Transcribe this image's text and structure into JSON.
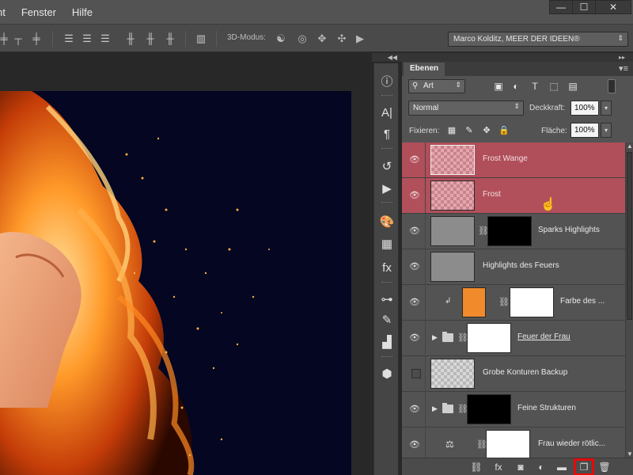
{
  "menu": {
    "items": [
      "nt",
      "Fenster",
      "Hilfe"
    ]
  },
  "window_controls": {
    "minimize": "—",
    "maximize": "☐",
    "close": "✕"
  },
  "options_bar": {
    "mode_label": "3D-Modus:",
    "workspace": "Marco Kolditz, MEER DER IDEEN®"
  },
  "layers_panel": {
    "tab_label": "Ebenen",
    "filter_kind": "Art",
    "blend_mode": "Normal",
    "opacity_label": "Deckkraft:",
    "opacity_value": "100%",
    "lock_label": "Fixieren:",
    "fill_label": "Fläche:",
    "fill_value": "100%",
    "layers": [
      {
        "name": "Frost Wange",
        "visible": true,
        "selected": true
      },
      {
        "name": "Frost",
        "visible": true,
        "selected": true
      },
      {
        "name": "Sparks Highlights",
        "visible": true,
        "selected": false
      },
      {
        "name": "Highlights des Feuers",
        "visible": true,
        "selected": false
      },
      {
        "name": "Farbe des ...",
        "visible": true,
        "selected": false
      },
      {
        "name": "Feuer der Frau",
        "visible": true,
        "selected": false
      },
      {
        "name": "Grobe Konturen Backup",
        "visible": false,
        "selected": false
      },
      {
        "name": "Feine Strukturen",
        "visible": true,
        "selected": false
      },
      {
        "name": "Frau wieder rötlic...",
        "visible": true,
        "selected": false
      }
    ]
  },
  "colors": {
    "selection": "#b1505b",
    "highlight_box": "#e20b0b",
    "canvas_background": "#040622",
    "fill_color_layer": "#f08a2a"
  }
}
